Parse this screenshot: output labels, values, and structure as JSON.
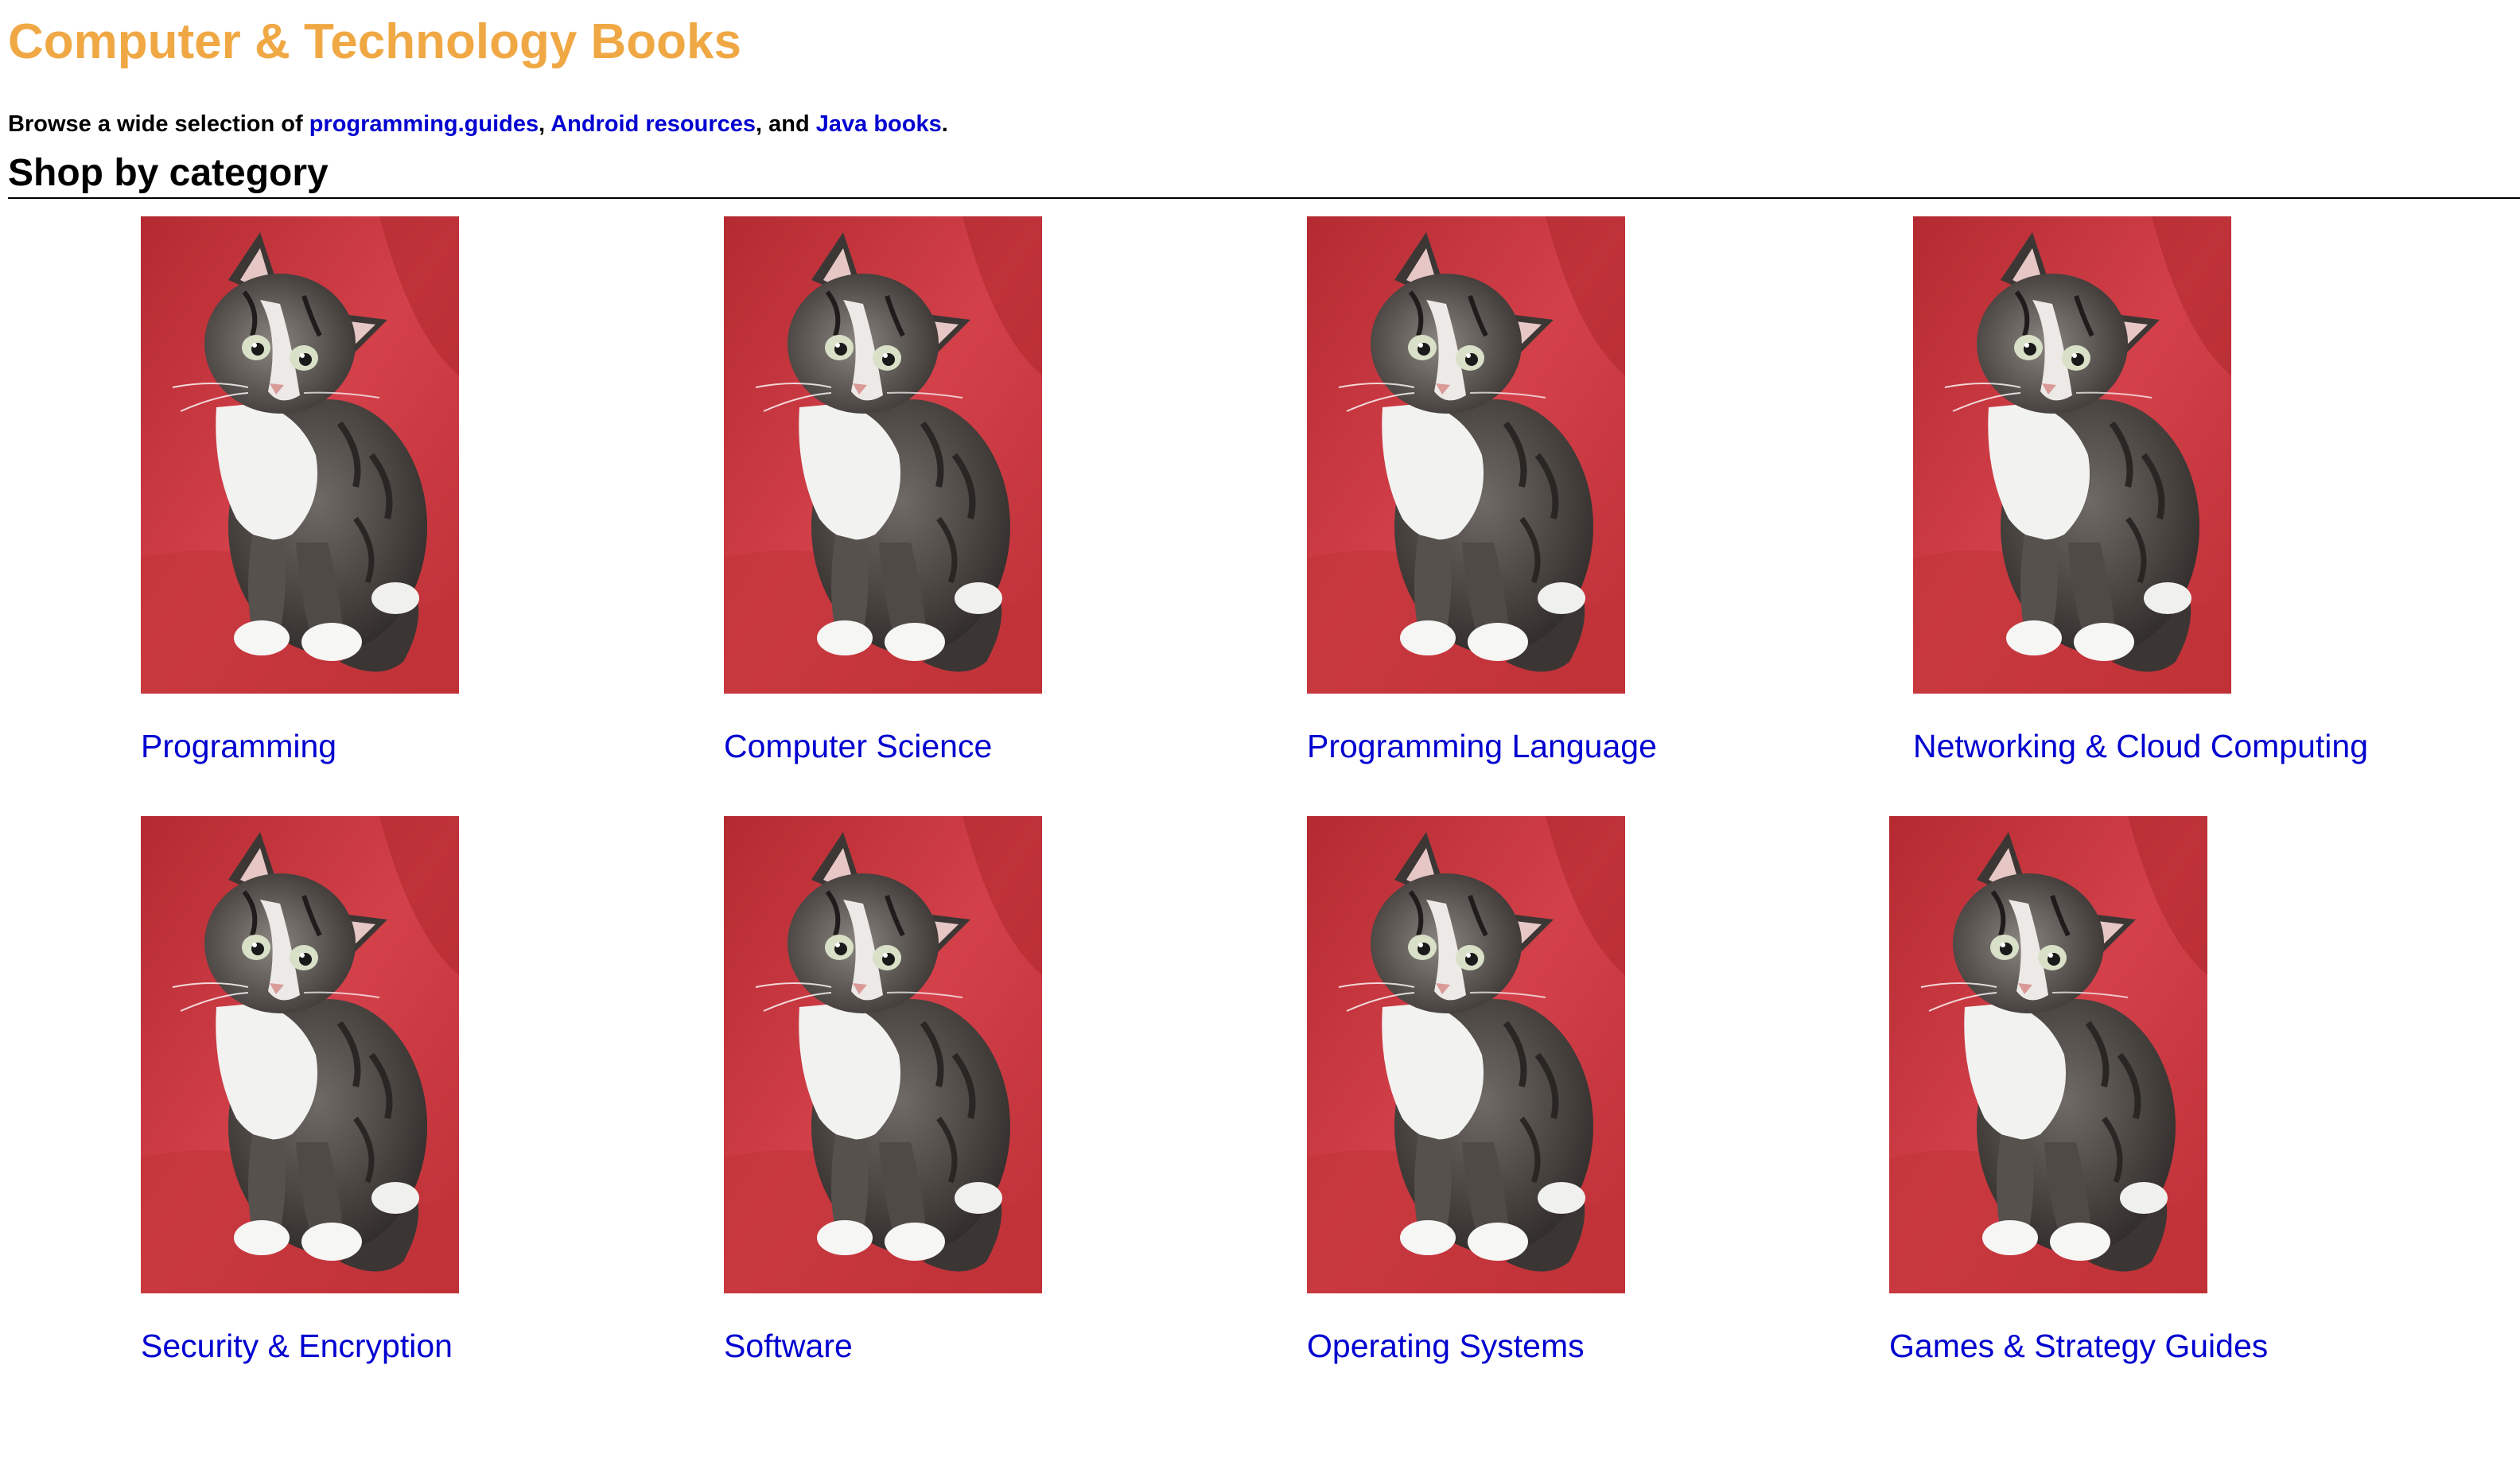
{
  "header": {
    "title": "Computer & Technology Books"
  },
  "intro": {
    "prefix": "Browse a wide selection of ",
    "link1": "programming.guides",
    "sep1": ", ",
    "link2": "Android resources",
    "sep2": ", and ",
    "link3": "Java books",
    "suffix": "."
  },
  "section": {
    "heading": "Shop by category"
  },
  "categories": [
    {
      "label": "Programming",
      "image_icon": "kitten-photo"
    },
    {
      "label": "Computer Science",
      "image_icon": "kitten-photo"
    },
    {
      "label": "Programming Language",
      "image_icon": "kitten-photo"
    },
    {
      "label": "Networking & Cloud Computing",
      "image_icon": "kitten-photo"
    },
    {
      "label": "Security & Encryption",
      "image_icon": "kitten-photo"
    },
    {
      "label": "Software",
      "image_icon": "kitten-photo"
    },
    {
      "label": "Operating Systems",
      "image_icon": "kitten-photo"
    },
    {
      "label": "Games & Strategy Guides",
      "image_icon": "kitten-photo"
    }
  ],
  "colors": {
    "title": "#f0a844",
    "link": "#0000d0",
    "text": "#000000",
    "photo_background": "#c8383a"
  }
}
